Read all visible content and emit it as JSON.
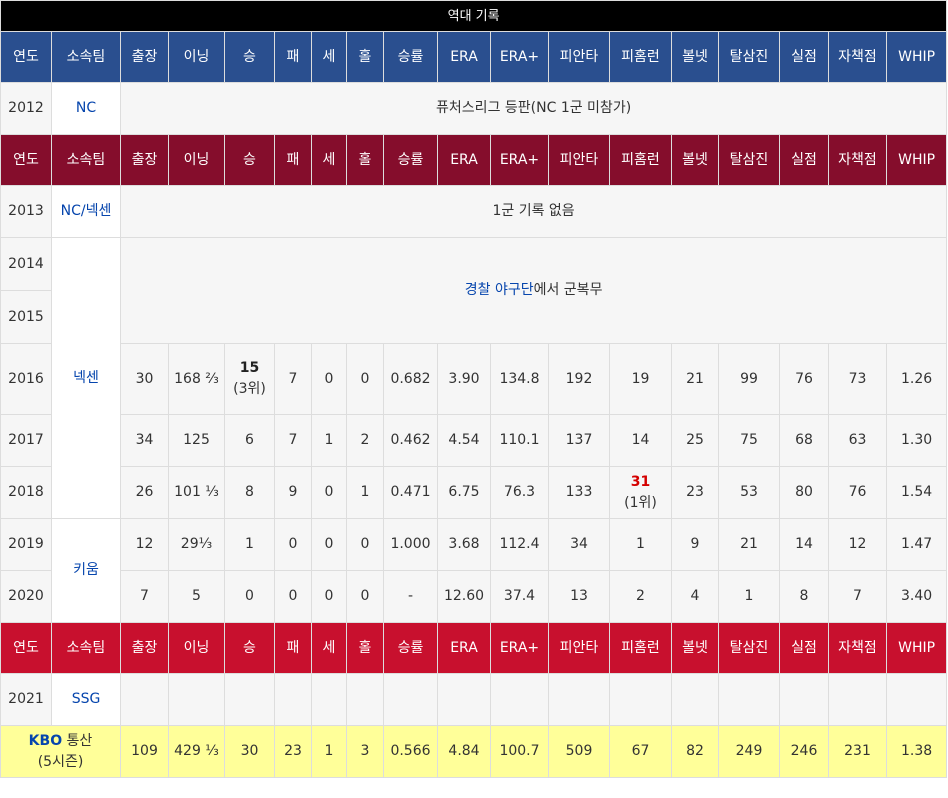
{
  "table_title": "역대 기록",
  "headers": [
    "연도",
    "소속팀",
    "출장",
    "이닝",
    "승",
    "패",
    "세",
    "홀",
    "승률",
    "ERA",
    "ERA+",
    "피안타",
    "피홈런",
    "볼넷",
    "탈삼진",
    "실점",
    "자책점",
    "WHIP"
  ],
  "colors": {
    "header_blue": "#2a4f8f",
    "header_maroon": "#850d2c",
    "header_red": "#c8102e",
    "total_bg": "#ffff99",
    "link": "#0645ad",
    "title_bg": "#000000"
  },
  "rows": {
    "y2012": {
      "year": "2012",
      "team": "NC",
      "note": "퓨처스리그 등판(NC 1군 미참가)"
    },
    "y2013": {
      "year": "2013",
      "team": "NC/넥센",
      "note": "1군 기록 없음"
    },
    "y2014": {
      "year": "2014"
    },
    "y2015": {
      "year": "2015"
    },
    "military": {
      "link": "경찰 야구단",
      "rest": "에서 군복무"
    },
    "team_nexen": "넥센",
    "team_kiwoom": "키움",
    "y2016": {
      "year": "2016",
      "g": "30",
      "ip": "168 ⅔",
      "w": "15",
      "w_note": "(3위)",
      "l": "7",
      "sv": "0",
      "hld": "0",
      "pct": "0.682",
      "era": "3.90",
      "era_plus": "134.8",
      "h": "192",
      "hr": "19",
      "bb": "21",
      "so": "99",
      "r": "76",
      "er": "73",
      "whip": "1.26"
    },
    "y2017": {
      "year": "2017",
      "g": "34",
      "ip": "125",
      "w": "6",
      "l": "7",
      "sv": "1",
      "hld": "2",
      "pct": "0.462",
      "era": "4.54",
      "era_plus": "110.1",
      "h": "137",
      "hr": "14",
      "bb": "25",
      "so": "75",
      "r": "68",
      "er": "63",
      "whip": "1.30"
    },
    "y2018": {
      "year": "2018",
      "g": "26",
      "ip": "101 ⅓",
      "w": "8",
      "l": "9",
      "sv": "0",
      "hld": "1",
      "pct": "0.471",
      "era": "6.75",
      "era_plus": "76.3",
      "h": "133",
      "hr": "31",
      "hr_note": "(1위)",
      "bb": "23",
      "so": "53",
      "r": "80",
      "er": "76",
      "whip": "1.54"
    },
    "y2019": {
      "year": "2019",
      "g": "12",
      "ip": "29⅓",
      "w": "1",
      "l": "0",
      "sv": "0",
      "hld": "0",
      "pct": "1.000",
      "era": "3.68",
      "era_plus": "112.4",
      "h": "34",
      "hr": "1",
      "bb": "9",
      "so": "21",
      "r": "14",
      "er": "12",
      "whip": "1.47"
    },
    "y2020": {
      "year": "2020",
      "g": "7",
      "ip": "5",
      "w": "0",
      "l": "0",
      "sv": "0",
      "hld": "0",
      "pct": "-",
      "era": "12.60",
      "era_plus": "37.4",
      "h": "13",
      "hr": "2",
      "bb": "4",
      "so": "1",
      "r": "8",
      "er": "7",
      "whip": "3.40"
    },
    "y2021": {
      "year": "2021",
      "team": "SSG"
    },
    "total": {
      "league": "KBO",
      "label": " 통산",
      "seasons": "(5시즌)",
      "g": "109",
      "ip": "429 ⅓",
      "w": "30",
      "l": "23",
      "sv": "1",
      "hld": "3",
      "pct": "0.566",
      "era": "4.84",
      "era_plus": "100.7",
      "h": "509",
      "hr": "67",
      "bb": "82",
      "so": "249",
      "r": "246",
      "er": "231",
      "whip": "1.38"
    }
  }
}
